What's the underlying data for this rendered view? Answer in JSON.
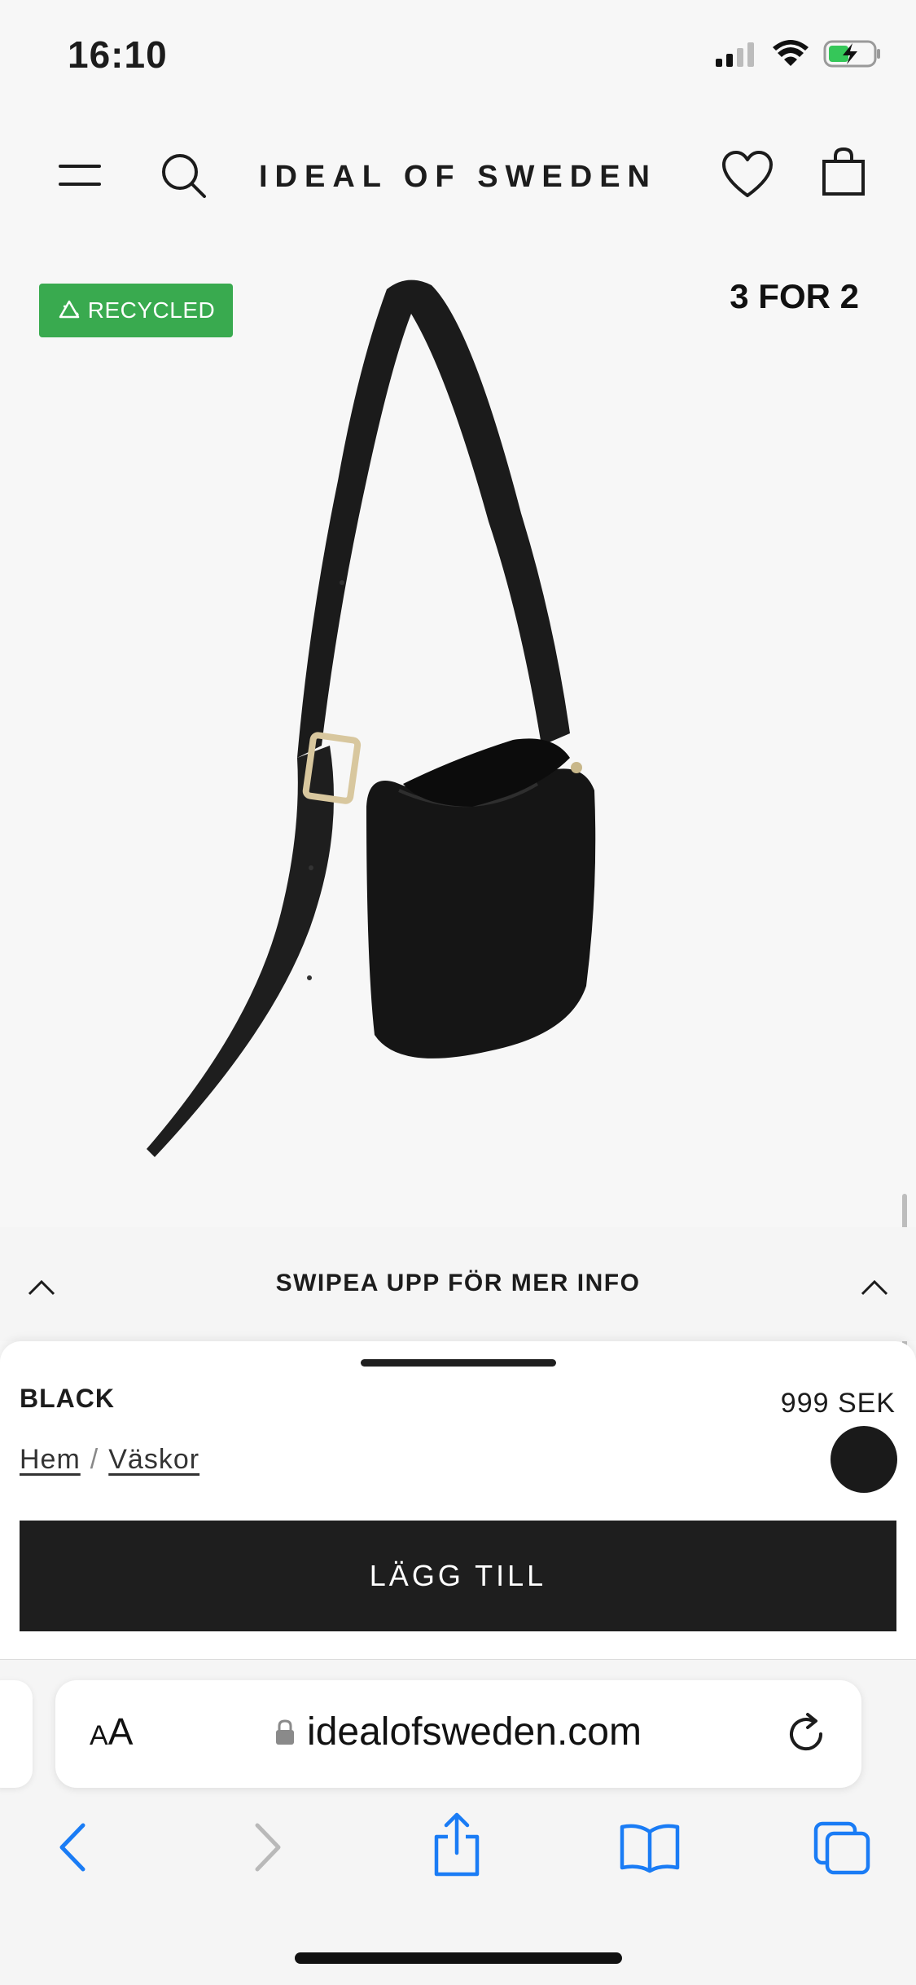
{
  "status_bar": {
    "time": "16:10",
    "icons": [
      "signal-icon",
      "wifi-icon",
      "battery-charging-icon"
    ]
  },
  "header": {
    "brand": "IDEAL OF SWEDEN",
    "icons": [
      "menu-icon",
      "search-icon",
      "heart-icon",
      "shopping-bag-icon"
    ]
  },
  "product_image": {
    "badge": "RECYCLED",
    "promo": "3 FOR 2",
    "badge_color": "#39aa4f"
  },
  "swipe": {
    "label": "SWIPEA UPP FÖR MER INFO"
  },
  "product": {
    "color_name": "BLACK",
    "price": "999 SEK",
    "breadcrumb": {
      "home": "Hem",
      "separator": "/",
      "category": "Väskor"
    },
    "swatch_color": "#1a1a1a",
    "add_label": "LÄGG TILL"
  },
  "browser": {
    "aa_label_small": "A",
    "aa_label_big": "A",
    "url": "idealofsweden.com",
    "toolbar_icons": [
      "back-icon",
      "forward-icon",
      "share-icon",
      "bookmarks-icon",
      "tabs-icon"
    ],
    "accent": "#1a7cf5"
  }
}
